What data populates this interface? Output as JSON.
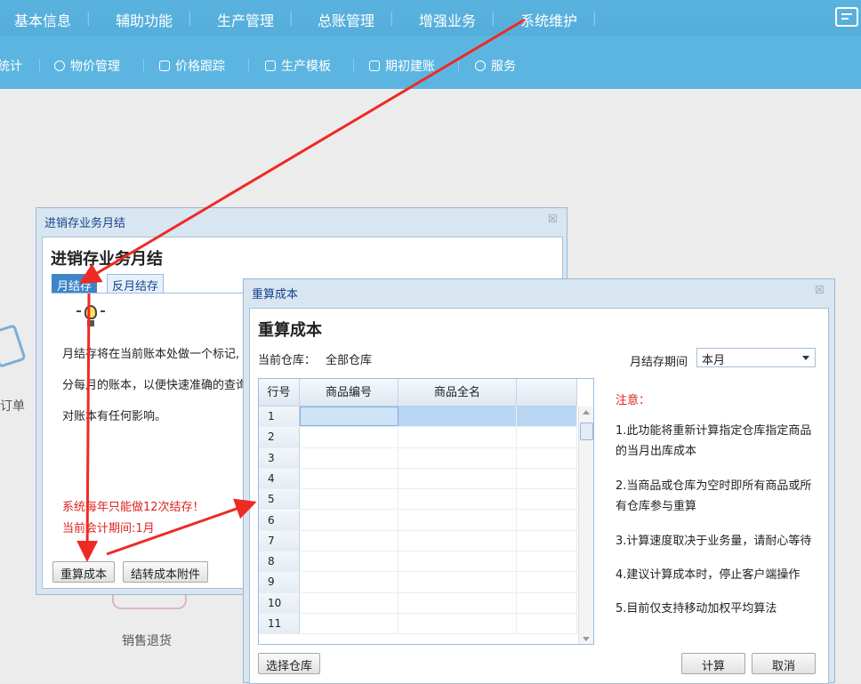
{
  "topnav": {
    "menus": [
      "基本信息",
      "辅助功能",
      "生产管理",
      "总账管理",
      "增强业务",
      "系统维护"
    ]
  },
  "subnav": {
    "items": [
      "统计",
      "物价管理",
      "价格跟踪",
      "生产模板",
      "期初建账",
      "服务"
    ]
  },
  "background": {
    "order_label": "订单",
    "return_label": "销售退货"
  },
  "dialog_monthly": {
    "title": "进销存业务月结",
    "heading": "进销存业务月结",
    "tabs": [
      "月结存",
      "反月结存"
    ],
    "para1": "月结存将在当前账本处做一个标记,",
    "para2": "分每月的账本，以便快速准确的查询",
    "para3": "对账本有任何影响。",
    "warn1": "系统每年只能做12次结存！",
    "warn2": "当前会计期间:1月",
    "btn_recalc": "重算成本",
    "btn_attach": "结转成本附件"
  },
  "dialog_recalc": {
    "title": "重算成本",
    "heading": "重算成本",
    "warehouse_label": "当前仓库：",
    "warehouse_value": "全部仓库",
    "period_label": "月结存期间",
    "period_value": "本月",
    "columns": [
      "行号",
      "商品编号",
      "商品全名"
    ],
    "rows": [
      "1",
      "2",
      "3",
      "4",
      "5",
      "6",
      "7",
      "8",
      "9",
      "10",
      "11"
    ],
    "note_title": "注意：",
    "notes": [
      "1.此功能将重新计算指定仓库指定商品的当月出库成本",
      "2.当商品或仓库为空时即所有商品或所有仓库参与重算",
      "3.计算速度取决于业务量，请耐心等待",
      "4.建议计算成本时，停止客户端操作",
      "5.目前仅支持移动加权平均算法"
    ],
    "btn_select_warehouse": "选择仓库",
    "btn_calc": "计算",
    "btn_cancel": "取消"
  },
  "colors": {
    "nav": "#55addb",
    "dialog_title": "#15428b",
    "warning": "#dd2222",
    "arrow": "#ee2a24"
  }
}
